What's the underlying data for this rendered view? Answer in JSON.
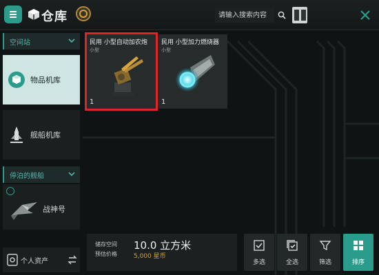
{
  "header": {
    "title": "仓库",
    "search": {
      "placeholder": "请输入搜索内容"
    }
  },
  "sidebar": {
    "groups": [
      {
        "label": "空间站"
      },
      {
        "label": "停泊的舰船"
      }
    ],
    "items": [
      {
        "label": "物品机库",
        "state": "active",
        "icon": "warehouse-icon"
      },
      {
        "label": "舰船机库",
        "state": "inactive",
        "icon": "ship-hangar-icon"
      }
    ],
    "ship": {
      "label": "战神号"
    },
    "assets": {
      "label": "个人资产"
    }
  },
  "items": [
    {
      "name": "民用 小型自动加农炮",
      "type": "小型",
      "qty": "1",
      "selected": true,
      "icon": "autocannon-icon"
    },
    {
      "name": "民用 小型加力燃烧器",
      "type": "小型",
      "qty": "1",
      "selected": false,
      "icon": "afterburner-icon"
    }
  ],
  "storage": {
    "space_label": "储存空间",
    "value_label": "预估价格",
    "space_value": "10.0 立方米",
    "price_value": "5,000 星币"
  },
  "actions": [
    {
      "label": "多选",
      "icon": "multi-select-icon"
    },
    {
      "label": "全选",
      "icon": "select-all-icon"
    },
    {
      "label": "筛选",
      "icon": "filter-icon"
    },
    {
      "label": "排序",
      "icon": "sort-icon",
      "active": true
    }
  ],
  "colors": {
    "accent": "#2b9c8c",
    "selection": "#e0242a",
    "currency": "#d9a43a"
  }
}
